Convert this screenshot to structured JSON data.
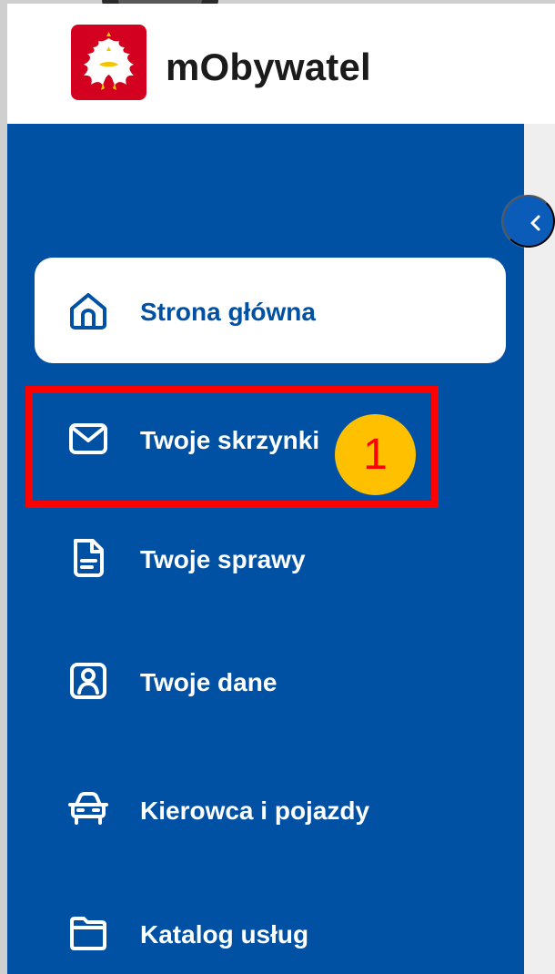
{
  "header": {
    "app_name": "mObywatel",
    "emblem_icon": "polish-eagle-emblem",
    "emblem_colors": {
      "shield": "#d4001f",
      "eagle": "#ffffff",
      "accents": "#f5c400"
    }
  },
  "sidebar": {
    "background": "#0051a3",
    "items": [
      {
        "label": "Strona główna",
        "icon": "home-icon",
        "active": true
      },
      {
        "label": "Twoje skrzynki",
        "icon": "mail-icon",
        "active": false
      },
      {
        "label": "Twoje sprawy",
        "icon": "document-icon",
        "active": false
      },
      {
        "label": "Twoje dane",
        "icon": "person-card-icon",
        "active": false
      },
      {
        "label": "Kierowca i pojazdy",
        "icon": "car-icon",
        "active": false
      },
      {
        "label": "Katalog usług",
        "icon": "folder-icon",
        "active": false
      }
    ]
  },
  "collapse_button": {
    "icon": "chevron-left-icon"
  },
  "annotation": {
    "number": "1",
    "box_color": "#ff0000",
    "badge_color": "#ffc000"
  }
}
